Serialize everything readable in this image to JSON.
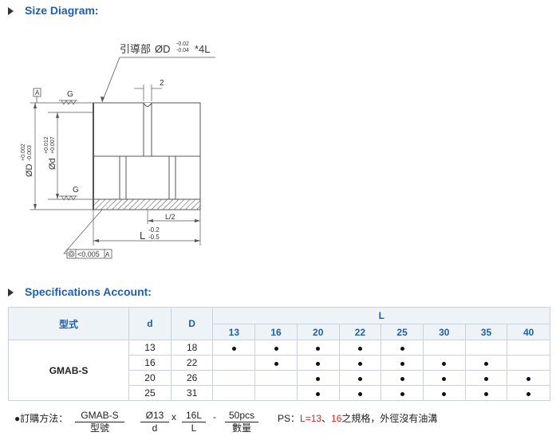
{
  "size_diagram": {
    "title": "Size Diagram:",
    "guide_label": "引導部",
    "guide_symbol": "ØD",
    "guide_tol_upper": "-0.02",
    "guide_tol_lower": "-0.04",
    "guide_suffix": "*4L",
    "groove_width": "2",
    "datum_letter": "A",
    "finish_mark": "G",
    "outer_dia_label": "ØD",
    "outer_dia_tol_upper": "+0.002",
    "outer_dia_tol_lower": "-0.003",
    "inner_dia_label": "Ød",
    "inner_dia_tol_upper": "+0.012",
    "inner_dia_tol_lower": "+0.007",
    "half_length": "L/2",
    "length_label": "L",
    "length_tol_upper": "-0.2",
    "length_tol_lower": "-0.5",
    "tolerance_value": "<0.005",
    "tolerance_datum": "A"
  },
  "spec": {
    "title": "Specifications Account:",
    "col_model": "型式",
    "col_d": "d",
    "col_D": "D",
    "col_L": "L",
    "L_values": [
      "13",
      "16",
      "20",
      "22",
      "25",
      "30",
      "35",
      "40"
    ],
    "model": "GMAB-S",
    "rows": [
      {
        "d": "13",
        "D": "18",
        "avail": [
          1,
          1,
          1,
          1,
          1,
          0,
          0,
          0
        ]
      },
      {
        "d": "16",
        "D": "22",
        "avail": [
          0,
          1,
          1,
          1,
          1,
          1,
          1,
          0
        ]
      },
      {
        "d": "20",
        "D": "26",
        "avail": [
          0,
          0,
          1,
          1,
          1,
          1,
          1,
          1
        ]
      },
      {
        "d": "25",
        "D": "31",
        "avail": [
          0,
          0,
          1,
          1,
          1,
          1,
          1,
          1
        ]
      }
    ]
  },
  "order": {
    "label": "●訂購方法：",
    "parts": [
      {
        "top": "GMAB-S",
        "bottom": "型號"
      },
      {
        "top": "Ø13",
        "bottom": "d"
      },
      {
        "top": "16L",
        "bottom": "L"
      },
      {
        "top": "50pcs",
        "bottom": "數量"
      }
    ],
    "sep_x": "x",
    "sep_dash": "-",
    "note_prefix": "PS：",
    "note_l": "L=13",
    "note_mid": "、",
    "note_16": "16",
    "note_suffix": "之規格，外徑沒有油溝"
  }
}
